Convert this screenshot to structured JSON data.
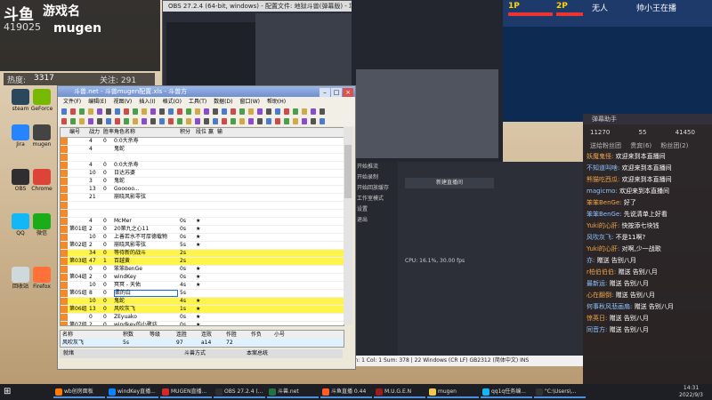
{
  "stream": {
    "brand": "斗鱼",
    "game_title": "游戏名",
    "room_number": "419025",
    "game_name": "mugen",
    "hot_label": "热度:",
    "hot_value": "3317",
    "fans_label": "关注: 291"
  },
  "desktop_icons": [
    {
      "label": "steam",
      "color": "#2a475e"
    },
    {
      "label": "GeForce",
      "color": "#76b900"
    },
    {
      "label": "Jira",
      "color": "#2684ff"
    },
    {
      "label": "mugen",
      "color": "#444"
    },
    {
      "label": "OBS",
      "color": "#302e31"
    },
    {
      "label": "Chrome",
      "color": "#db4437"
    },
    {
      "label": "QQ",
      "color": "#12b7f5"
    },
    {
      "label": "微信",
      "color": "#1aad19"
    },
    {
      "label": "回收站",
      "color": "#cfd8dc"
    },
    {
      "label": "Firefox",
      "color": "#ff7139"
    }
  ],
  "obs": {
    "title": "OBS 27.2.4 (64-bit, windows) - 配置文件: 地狱斗兽(弹幕版) - 场景: 地狱斗兽(弹幕版)"
  },
  "mugen": {
    "p1_label": "1P",
    "p2_label": "2P",
    "round": "无人",
    "title": "帅小王在播",
    "chat_header": "弹幕助手",
    "stats": [
      "11270",
      "55",
      "41450"
    ],
    "tabs": [
      "送给粉丝团",
      "贵宾(6)",
      "粉丝团(2)"
    ]
  },
  "chat_messages": [
    {
      "user": "妖魔鬼怪",
      "text": "欢迎来到本直播间"
    },
    {
      "user": "不知道叫啥",
      "text": "欢迎来到本直播间"
    },
    {
      "user": "熊猫吃西瓜",
      "text": "欢迎来到本直播间"
    },
    {
      "user": "magicmo",
      "text": "欢迎来到本直播间"
    },
    {
      "user": "笨笨BenGe",
      "text": "好了"
    },
    {
      "user": "笨笨BenGe",
      "text": "先说清单上好看"
    },
    {
      "user": "Yuki的心肝",
      "text": "快按添七块钱"
    },
    {
      "user": "风吹灰飞",
      "text": "不是11啊?"
    },
    {
      "user": "Yuki的心肝",
      "text": "对啊,少一战歌"
    },
    {
      "user": "亦",
      "text": "赠送 告别八月"
    },
    {
      "user": "r柏伯伯伯",
      "text": "赠送 告别八月"
    },
    {
      "user": "最新运",
      "text": "赠送 告别八月"
    },
    {
      "user": "心在翻倒",
      "text": "赠送 告别八月"
    },
    {
      "user": "何事秋风悲画扇",
      "text": "赠送 告别八月"
    },
    {
      "user": "惊英日",
      "text": "赠送 告别八月"
    },
    {
      "user": "同音方",
      "text": "赠送 告别八月"
    }
  ],
  "editor": {
    "title": "斗兽.net - 斗兽mugen配置.xls - 斗兽方",
    "menu": [
      "文件(F)",
      "编辑(E)",
      "视图(V)",
      "插入(I)",
      "格式(O)",
      "工具(T)",
      "数据(D)",
      "窗口(W)",
      "帮助(H)"
    ],
    "columns": [
      "编号",
      "战力",
      "胜率",
      "角色名称",
      "积分",
      "段位",
      "赢",
      "输"
    ],
    "rows": [
      {
        "a": "",
        "b": "4",
        "c": "0",
        "d": "0:0大杀寿",
        "e": "",
        "f": "",
        "hl": false
      },
      {
        "a": "",
        "b": "4",
        "c": "",
        "d": "鬼蛇",
        "e": "",
        "f": "",
        "hl": false
      },
      {
        "a": "",
        "b": "",
        "c": "",
        "d": "",
        "e": "",
        "f": "",
        "hl": false
      },
      {
        "a": "",
        "b": "4",
        "c": "0",
        "d": "0:0大杀寿",
        "e": "",
        "f": "",
        "hl": false
      },
      {
        "a": "",
        "b": "10",
        "c": "0",
        "d": "日达苏婆",
        "e": "",
        "f": "",
        "hl": false
      },
      {
        "a": "",
        "b": "3",
        "c": "0",
        "d": "鬼蛇",
        "e": "",
        "f": "",
        "hl": false
      },
      {
        "a": "",
        "b": "13",
        "c": "0",
        "d": "Gooooo...",
        "e": "",
        "f": "",
        "hl": false
      },
      {
        "a": "",
        "b": "21",
        "c": "",
        "d": "崩晓风影零弦",
        "e": "",
        "f": "",
        "hl": false
      },
      {
        "a": "",
        "b": "",
        "c": "",
        "d": "",
        "e": "",
        "f": "",
        "hl": false
      },
      {
        "a": "",
        "b": "",
        "c": "",
        "d": "",
        "e": "",
        "f": "",
        "hl": false
      },
      {
        "a": "",
        "b": "4",
        "c": "0",
        "d": "McMer",
        "e": "0s",
        "f": "★",
        "hl": false
      },
      {
        "a": "第01组",
        "b": "2",
        "c": "0",
        "d": "20第九之心11",
        "e": "0s",
        "f": "★",
        "hl": false
      },
      {
        "a": "",
        "b": "10",
        "c": "0",
        "d": "上善若水不可厚德载物",
        "e": "0s",
        "f": "★",
        "hl": false
      },
      {
        "a": "第02组",
        "b": "2",
        "c": "0",
        "d": "崩晓风影零弦",
        "e": "5s",
        "f": "★",
        "hl": false
      },
      {
        "a": "",
        "b": "34",
        "c": "0",
        "d": "等待新的战斗",
        "e": "2s",
        "f": "",
        "hl": true
      },
      {
        "a": "第03组",
        "b": "47",
        "c": "1",
        "d": "百越黄",
        "e": "2s",
        "f": "",
        "hl": true
      },
      {
        "a": "",
        "b": "0",
        "c": "0",
        "d": "笨笨BenGe",
        "e": "0s",
        "f": "★",
        "hl": false
      },
      {
        "a": "第04组",
        "b": "2",
        "c": "0",
        "d": "windKey",
        "e": "0s",
        "f": "★",
        "hl": false
      },
      {
        "a": "",
        "b": "10",
        "c": "0",
        "d": "冥冥 - 天佑",
        "e": "4s",
        "f": "★",
        "hl": false
      },
      {
        "a": "第05组",
        "b": "8",
        "c": "0",
        "d": "柔的白",
        "e": "5s",
        "f": "",
        "hl": false
      },
      {
        "a": "",
        "b": "10",
        "c": "0",
        "d": "鬼蛇",
        "e": "4s",
        "f": "★",
        "hl": true
      },
      {
        "a": "第06组",
        "b": "13",
        "c": "0",
        "d": "风吹灰飞",
        "e": "1s",
        "f": "★",
        "hl": true
      },
      {
        "a": "",
        "b": "0",
        "c": "0",
        "d": "ZEyuako",
        "e": "0s",
        "f": "★",
        "hl": false
      },
      {
        "a": "第07组",
        "b": "2",
        "c": "0",
        "d": "windkey的小骤坊",
        "e": "0s",
        "f": "★",
        "hl": false
      },
      {
        "a": "",
        "b": "0",
        "c": "0",
        "d": "七班线和赤的鸭",
        "e": "0s",
        "f": "★",
        "hl": false
      },
      {
        "a": "第08组",
        "b": "3",
        "c": "0",
        "d": "Yuki的心肝慢怪",
        "e": "0s",
        "f": "★",
        "hl": false
      },
      {
        "a": "",
        "b": "0",
        "c": "0",
        "d": "西南草市场",
        "e": "0s",
        "f": "★",
        "hl": false
      },
      {
        "a": "第09组",
        "b": "2",
        "c": "0",
        "d": "湛湛涛涛歌",
        "e": "9s",
        "f": "★",
        "hl": false
      },
      {
        "a": "",
        "b": "0",
        "c": "0",
        "d": "脚日分布命",
        "e": "0s",
        "f": "★",
        "hl": false
      },
      {
        "a": "第10组",
        "b": "",
        "c": "0",
        "d": "孙合神族",
        "e": "0s",
        "f": "★",
        "hl": false
      }
    ],
    "sub_headers": [
      "名称",
      "",
      "积数",
      "等级",
      "连胜",
      "连败",
      "作胜",
      "作负",
      "小号"
    ],
    "sub_values": [
      "风吹灰飞",
      "",
      "5s",
      "",
      "97",
      "a14",
      "72",
      "",
      ""
    ],
    "status": {
      "left": "就绪",
      "right": "",
      "sheet": "斗兽方式",
      "mode": "本案总统"
    },
    "cell_ref": "B3"
  },
  "dark_window": {
    "sidebar": [
      "开始推流",
      "开始录制",
      "开始回放缓存",
      "工作室模式",
      "设置",
      "退出"
    ],
    "stats": "CPU: 16.1%, 30.00 fps",
    "buttons": [
      "新建直播间"
    ]
  },
  "notepad": {
    "text": "Ln: 1   Col: 1   Sum: 378 | 22        Windows (CR LF)   GB2312 (简体中文)   INS"
  },
  "taskbar": {
    "tasks": [
      {
        "label": "wb创房面板",
        "color": "#ff7a00"
      },
      {
        "label": "windKey直播...",
        "color": "#0a84ff"
      },
      {
        "label": "MUGEN直播...",
        "color": "#d62828"
      },
      {
        "label": "OBS 27.2.4 (...",
        "color": "#302e31"
      },
      {
        "label": "斗兽.net",
        "color": "#217346"
      },
      {
        "label": "斗鱼直播 0.44",
        "color": "#ff5d23"
      },
      {
        "label": "M.U.G.E.N",
        "color": "#9b1c1c"
      },
      {
        "label": "mugen",
        "color": "#f2c94c"
      },
      {
        "label": "qq1q任务编...",
        "color": "#12b7f5"
      },
      {
        "label": "\"C:\\Users\\...",
        "color": "#333"
      }
    ],
    "time": "14:31",
    "date": "2022/9/3"
  }
}
